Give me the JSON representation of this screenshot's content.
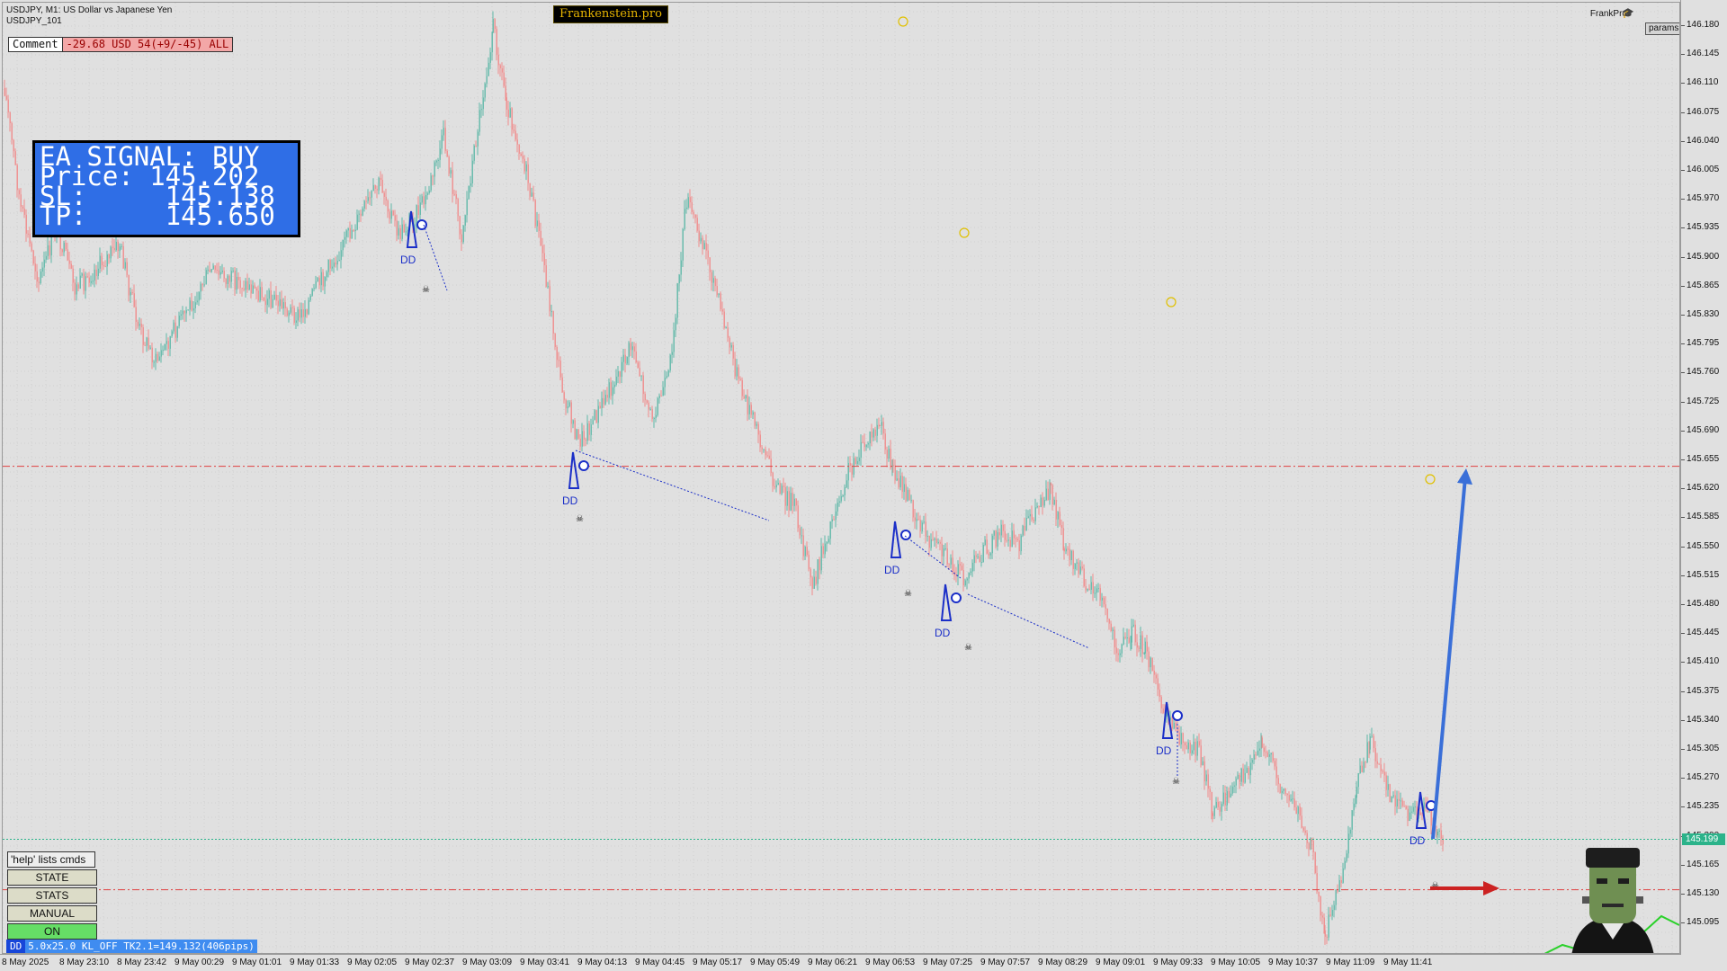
{
  "header": {
    "symbol_line": "USDJPY, M1:  US Dollar vs Japanese Yen",
    "sub_line": "USDJPY_101",
    "brand": "Frankenstein.pro",
    "user": "FrankPro",
    "params": "params"
  },
  "comment": {
    "label": "Comment",
    "value": "-29.68 USD 54(+9/-45) ALL"
  },
  "signal": {
    "line1": "EA SIGNAL: BUY",
    "line2": "Price: 145.202",
    "line3": "SL:     145.138",
    "line4": "TP:     145.650"
  },
  "commands": {
    "help": "'help' lists cmds",
    "state": "STATE",
    "stats": "STATS",
    "manual": "MANUAL",
    "on": "ON"
  },
  "status": {
    "tag": "DD",
    "text": "5.0x25.0 KL_OFF TK2.1=149.132(406pips)"
  },
  "price_axis": {
    "ticks": [
      "146.180",
      "146.145",
      "146.110",
      "146.075",
      "146.040",
      "146.005",
      "145.970",
      "145.935",
      "145.900",
      "145.865",
      "145.830",
      "145.795",
      "145.760",
      "145.725",
      "145.690",
      "145.655",
      "145.620",
      "145.585",
      "145.550",
      "145.515",
      "145.480",
      "145.445",
      "145.410",
      "145.375",
      "145.340",
      "145.305",
      "145.270",
      "145.235",
      "145.200",
      "145.165",
      "145.130",
      "145.095"
    ],
    "current": "145.199"
  },
  "time_axis": {
    "ticks": [
      "8 May 2025",
      "8 May 23:10",
      "8 May 23:42",
      "9 May 00:29",
      "9 May 01:01",
      "9 May 01:33",
      "9 May 02:05",
      "9 May 02:37",
      "9 May 03:09",
      "9 May 03:41",
      "9 May 04:13",
      "9 May 04:45",
      "9 May 05:17",
      "9 May 05:49",
      "9 May 06:21",
      "9 May 06:53",
      "9 May 07:25",
      "9 May 07:57",
      "9 May 08:29",
      "9 May 09:01",
      "9 May 09:33",
      "9 May 10:05",
      "9 May 10:37",
      "9 May 11:09",
      "9 May 11:41"
    ]
  },
  "markers": {
    "dd_label": "DD"
  },
  "colors": {
    "bull": "#5fb8a8",
    "bear": "#f08c8c",
    "signal_bg": "#2f6ee6",
    "tp_line": "#e04040",
    "current_line": "#2bb38a",
    "arrow_up": "#3a6fd8",
    "arrow_sl": "#cc2222"
  }
}
